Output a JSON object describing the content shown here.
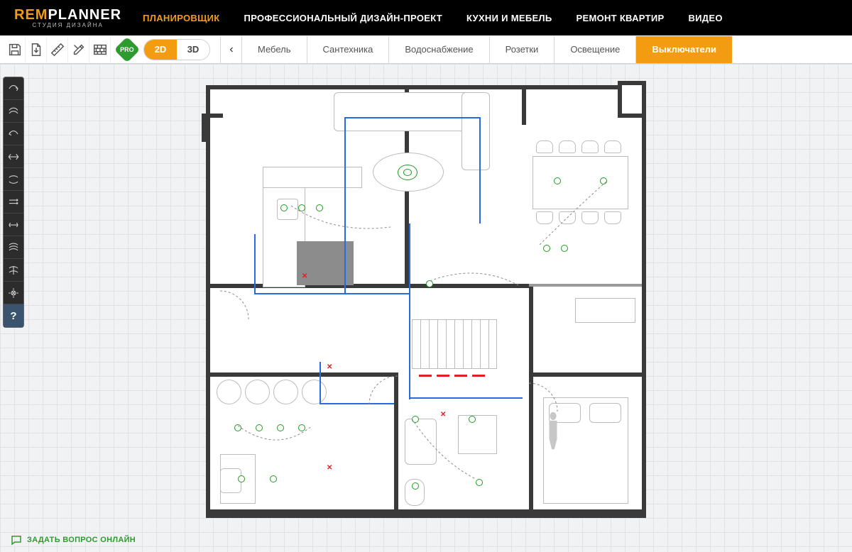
{
  "brand": {
    "name_part1": "REM",
    "name_part2": "PLANNER",
    "subtitle": "СТУДИЯ ДИЗАЙНА"
  },
  "nav": {
    "items": [
      {
        "label": "ПЛАНИРОВЩИК",
        "active": true
      },
      {
        "label": "ПРОФЕССИОНАЛЬНЫЙ ДИЗАЙН-ПРОЕКТ",
        "active": false
      },
      {
        "label": "КУХНИ И МЕБЕЛЬ",
        "active": false
      },
      {
        "label": "РЕМОНТ КВАРТИР",
        "active": false
      },
      {
        "label": "ВИДЕО",
        "active": false
      }
    ]
  },
  "toolbar": {
    "buttons": [
      "save",
      "file",
      "measure",
      "tools",
      "wall-tool"
    ],
    "pro_label": "PRO",
    "view_2d": "2D",
    "view_3d": "3D",
    "active_view": "2D"
  },
  "categories": {
    "items": [
      {
        "label": "Мебель",
        "active": false
      },
      {
        "label": "Сантехника",
        "active": false
      },
      {
        "label": "Водоснабжение",
        "active": false
      },
      {
        "label": "Розетки",
        "active": false
      },
      {
        "label": "Освещение",
        "active": false
      },
      {
        "label": "Выключатели",
        "active": true
      }
    ]
  },
  "sidebar": {
    "tools": [
      "switch-type-1",
      "switch-type-2",
      "switch-type-3",
      "switch-type-4",
      "switch-type-5",
      "switch-type-6",
      "switch-type-7",
      "switch-type-8",
      "switch-type-9",
      "sensor"
    ],
    "help_label": "?"
  },
  "colors": {
    "accent": "#f39c12",
    "success": "#2e9b2e",
    "wall": "#3a3a3a",
    "wire": "#2a6ae0"
  },
  "ask": {
    "label": "ЗАДАТЬ ВОПРОС ОНЛАЙН"
  }
}
